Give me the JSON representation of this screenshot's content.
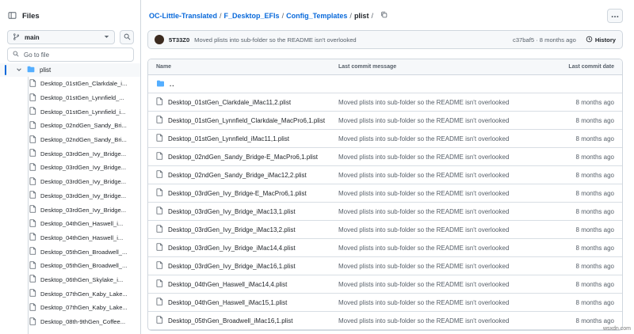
{
  "sidebar": {
    "title": "Files",
    "branch": "main",
    "goto_placeholder": "Go to file",
    "folder": "plist",
    "items": [
      "Desktop_01stGen_Clarkdale_i...",
      "Desktop_01stGen_Lynnfield_...",
      "Desktop_01stGen_Lynnfield_i...",
      "Desktop_02ndGen_Sandy_Bri...",
      "Desktop_02ndGen_Sandy_Bri...",
      "Desktop_03rdGen_Ivy_Bridge...",
      "Desktop_03rdGen_Ivy_Bridge...",
      "Desktop_03rdGen_Ivy_Bridge...",
      "Desktop_03rdGen_Ivy_Bridge...",
      "Desktop_03rdGen_Ivy_Bridge...",
      "Desktop_04thGen_Haswell_i...",
      "Desktop_04thGen_Haswell_i...",
      "Desktop_05thGen_Broadwell_...",
      "Desktop_05thGen_Broadwell_...",
      "Desktop_06thGen_Skylake_i...",
      "Desktop_07thGen_Kaby_Lake...",
      "Desktop_07thGen_Kaby_Lake...",
      "Desktop_08th-9thGen_Coffee..."
    ]
  },
  "breadcrumb": {
    "repo": "OC-Little-Translated",
    "p1": "F_Desktop_EFIs",
    "p2": "Config_Templates",
    "current": "plist",
    "sep": "/"
  },
  "commit": {
    "author": "5T33Z0",
    "message": "Moved plists into sub-folder so the README isn't overlooked",
    "meta": "c37baf5 · 8 months ago",
    "history": "History"
  },
  "table": {
    "headers": {
      "name": "Name",
      "message": "Last commit message",
      "date": "Last commit date"
    },
    "parent": "..",
    "rows": [
      {
        "name": "Desktop_01stGen_Clarkdale_iMac11,2.plist",
        "message": "Moved plists into sub-folder so the README isn't overlooked",
        "date": "8 months ago"
      },
      {
        "name": "Desktop_01stGen_Lynnfield_Clarkdale_MacPro6,1.plist",
        "message": "Moved plists into sub-folder so the README isn't overlooked",
        "date": "8 months ago"
      },
      {
        "name": "Desktop_01stGen_Lynnfield_iMac11,1.plist",
        "message": "Moved plists into sub-folder so the README isn't overlooked",
        "date": "8 months ago"
      },
      {
        "name": "Desktop_02ndGen_Sandy_Bridge-E_MacPro6,1.plist",
        "message": "Moved plists into sub-folder so the README isn't overlooked",
        "date": "8 months ago"
      },
      {
        "name": "Desktop_02ndGen_Sandy_Bridge_iMac12,2.plist",
        "message": "Moved plists into sub-folder so the README isn't overlooked",
        "date": "8 months ago"
      },
      {
        "name": "Desktop_03rdGen_Ivy_Bridge-E_MacPro6,1.plist",
        "message": "Moved plists into sub-folder so the README isn't overlooked",
        "date": "8 months ago"
      },
      {
        "name": "Desktop_03rdGen_Ivy_Bridge_iMac13,1.plist",
        "message": "Moved plists into sub-folder so the README isn't overlooked",
        "date": "8 months ago"
      },
      {
        "name": "Desktop_03rdGen_Ivy_Bridge_iMac13,2.plist",
        "message": "Moved plists into sub-folder so the README isn't overlooked",
        "date": "8 months ago"
      },
      {
        "name": "Desktop_03rdGen_Ivy_Bridge_iMac14,4.plist",
        "message": "Moved plists into sub-folder so the README isn't overlooked",
        "date": "8 months ago"
      },
      {
        "name": "Desktop_03rdGen_Ivy_Bridge_iMac16,1.plist",
        "message": "Moved plists into sub-folder so the README isn't overlooked",
        "date": "8 months ago"
      },
      {
        "name": "Desktop_04thGen_Haswell_iMac14,4.plist",
        "message": "Moved plists into sub-folder so the README isn't overlooked",
        "date": "8 months ago"
      },
      {
        "name": "Desktop_04thGen_Haswell_iMac15,1.plist",
        "message": "Moved plists into sub-folder so the README isn't overlooked",
        "date": "8 months ago"
      },
      {
        "name": "Desktop_05thGen_Broadwell_iMac16,1.plist",
        "message": "Moved plists into sub-folder so the README isn't overlooked",
        "date": "8 months ago"
      }
    ]
  },
  "watermark": "wsxdn.com",
  "colors": {
    "link": "#0969da",
    "folder": "#54aeff",
    "border": "#d0d7de"
  }
}
